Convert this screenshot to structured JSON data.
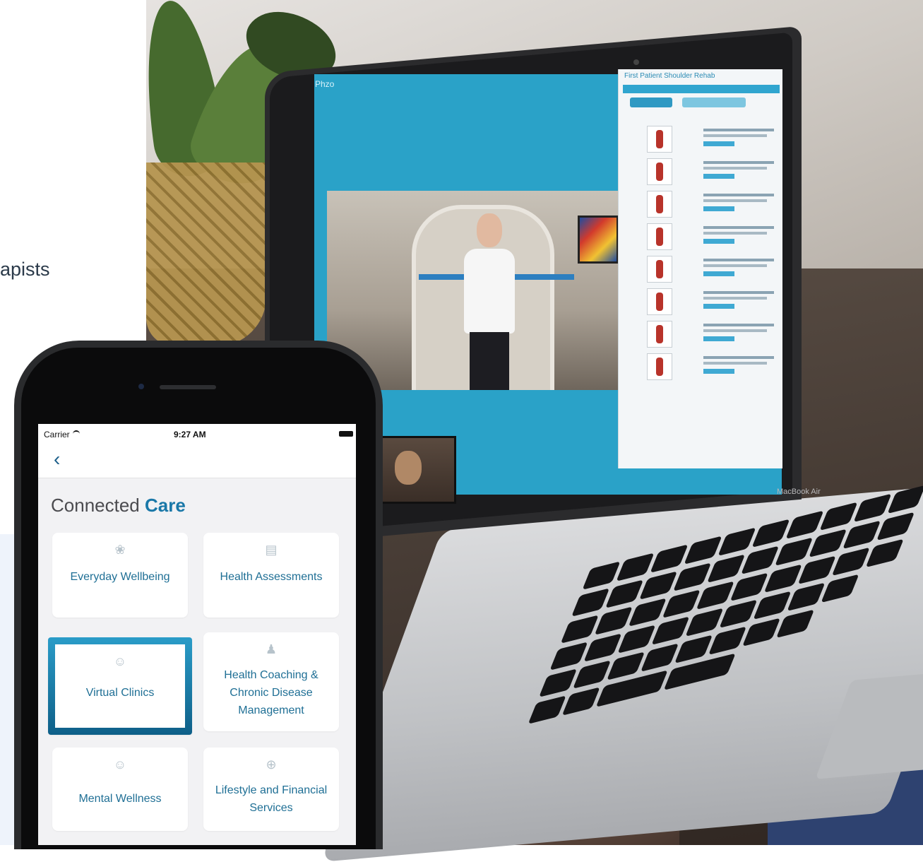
{
  "left": {
    "fragment_text": "apists"
  },
  "laptop": {
    "app_logo": "Phzo",
    "panel_title": "First Patient Shoulder Rehab",
    "brand_label": "MacBook Air"
  },
  "phone": {
    "status": {
      "carrier": "Carrier",
      "time": "9:27 AM"
    },
    "back_icon": "chevron-left",
    "title_plain": "Connected ",
    "title_accent": "Care",
    "tiles": [
      {
        "label": "Everyday Wellbeing",
        "icon": "lotus"
      },
      {
        "label": "Health Assessments",
        "icon": "bar-chart"
      },
      {
        "label": "Virtual Clinics",
        "icon": "people",
        "selected": true
      },
      {
        "label": "Health Coaching & Chronic Disease Management",
        "icon": "person-coach"
      },
      {
        "label": "Mental Wellness",
        "icon": "head"
      },
      {
        "label": "Lifestyle and Financial Services",
        "icon": "plus-circle"
      }
    ]
  },
  "colors": {
    "accent": "#1a78a8",
    "screen_teal": "#2aa2c8",
    "tile_gradient_top": "#2a9cc8",
    "tile_gradient_bottom": "#0e5f88"
  }
}
